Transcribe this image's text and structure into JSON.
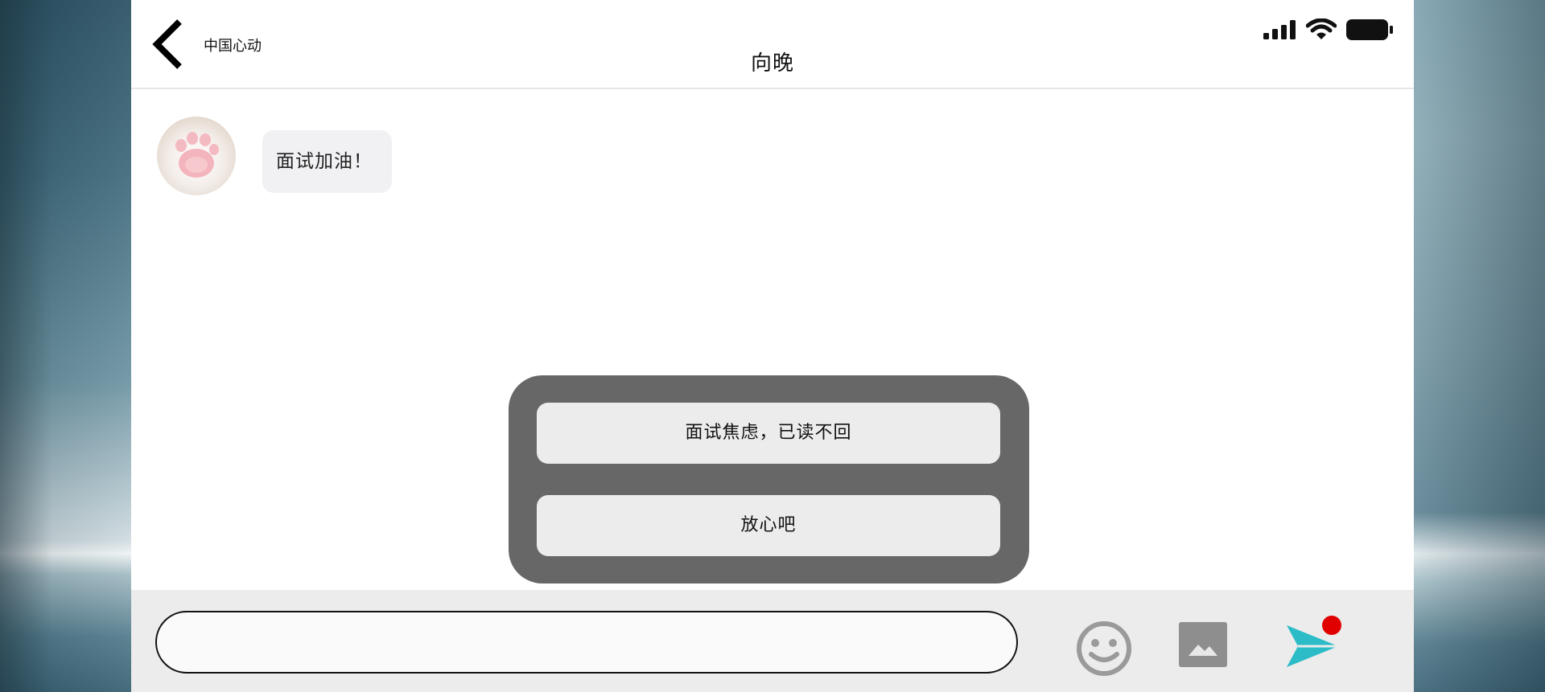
{
  "header": {
    "back_label": "中国心动",
    "title": "向晚"
  },
  "messages": [
    {
      "sender": "向晚",
      "text": "面试加油！"
    }
  ],
  "choices": [
    {
      "label": "面试焦虑，已读不回"
    },
    {
      "label": "放心吧"
    }
  ],
  "input": {
    "value": "",
    "placeholder": ""
  },
  "colors": {
    "send_accent": "#2bbcc7",
    "notification_dot": "#e00000",
    "popup_bg": "#676767",
    "option_bg": "#ececec"
  }
}
